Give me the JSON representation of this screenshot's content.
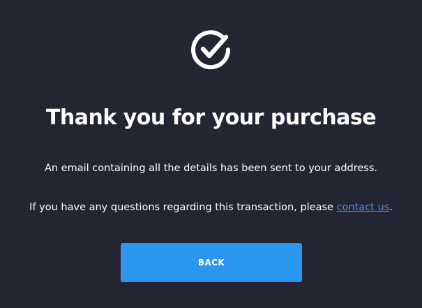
{
  "icon": "check-circle-icon",
  "title": "Thank you for your purchase",
  "message": {
    "email_line": "An email containing all the details has been sent to your address.",
    "questions_prefix": "If you have any questions regarding this transaction, please ",
    "contact_link": "contact us",
    "questions_suffix": "."
  },
  "back_button": {
    "label": "BACK"
  },
  "colors": {
    "background": "#242533",
    "text": "#ffffff",
    "link": "#3f93ee",
    "button": "#2b96ee"
  }
}
